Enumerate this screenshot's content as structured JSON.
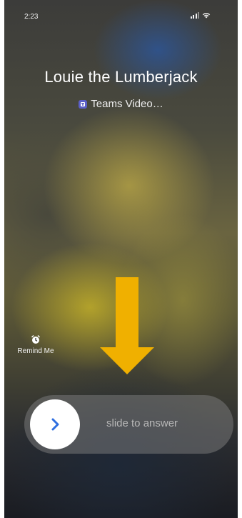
{
  "status_bar": {
    "time": "2:23",
    "icons": [
      "signal-icon",
      "wifi-icon"
    ]
  },
  "call": {
    "caller_name": "Louie the Lumberjack",
    "call_type": "Teams Video…",
    "app_icon": "teams-icon"
  },
  "remind": {
    "label": "Remind Me",
    "icon": "alarm-clock-icon"
  },
  "annotation": {
    "icon": "down-arrow-icon",
    "color": "#f0b000"
  },
  "answer_slider": {
    "label": "slide to answer",
    "icon": "chevron-right-icon",
    "accent": "#2f6fe0"
  }
}
